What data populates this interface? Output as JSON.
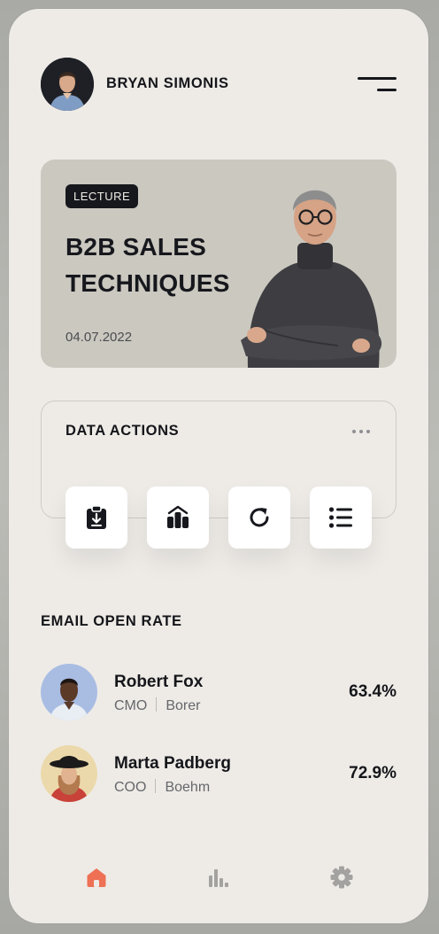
{
  "header": {
    "user_name": "BRYAN SIMONIS",
    "avatar_icon": "user-avatar",
    "menu_icon": "hamburger-icon"
  },
  "lecture": {
    "badge": "LECTURE",
    "title_line1": "B2B SALES",
    "title_line2": "TECHNIQUES",
    "date": "04.07.2022",
    "image_icon": "lecturer-photo",
    "background_color": "#cbc8c0"
  },
  "data_actions": {
    "title": "DATA ACTIONS",
    "more_icon": "more-horizontal-icon",
    "buttons": [
      {
        "icon": "clipboard-download-icon"
      },
      {
        "icon": "chart-bars-icon"
      },
      {
        "icon": "refresh-icon"
      },
      {
        "icon": "list-icon"
      }
    ]
  },
  "email_open_rate": {
    "title": "EMAIL OPEN RATE",
    "people": [
      {
        "name": "Robert Fox",
        "role": "CMO",
        "company": "Borer",
        "value": "63.4%",
        "avatar_color": "#a9bde3"
      },
      {
        "name": "Marta Padberg",
        "role": "COO",
        "company": "Boehm",
        "value": "72.9%",
        "avatar_color": "#ecd9ab"
      }
    ]
  },
  "bottom_nav": {
    "items": [
      {
        "icon": "home-icon",
        "active": true
      },
      {
        "icon": "bar-chart-icon",
        "active": false
      },
      {
        "icon": "settings-icon",
        "active": false
      }
    ],
    "active_color": "#ee7055",
    "inactive_color": "#a4a2a0"
  },
  "colors": {
    "background": "#eeebe7",
    "text_dark": "#15161a"
  }
}
